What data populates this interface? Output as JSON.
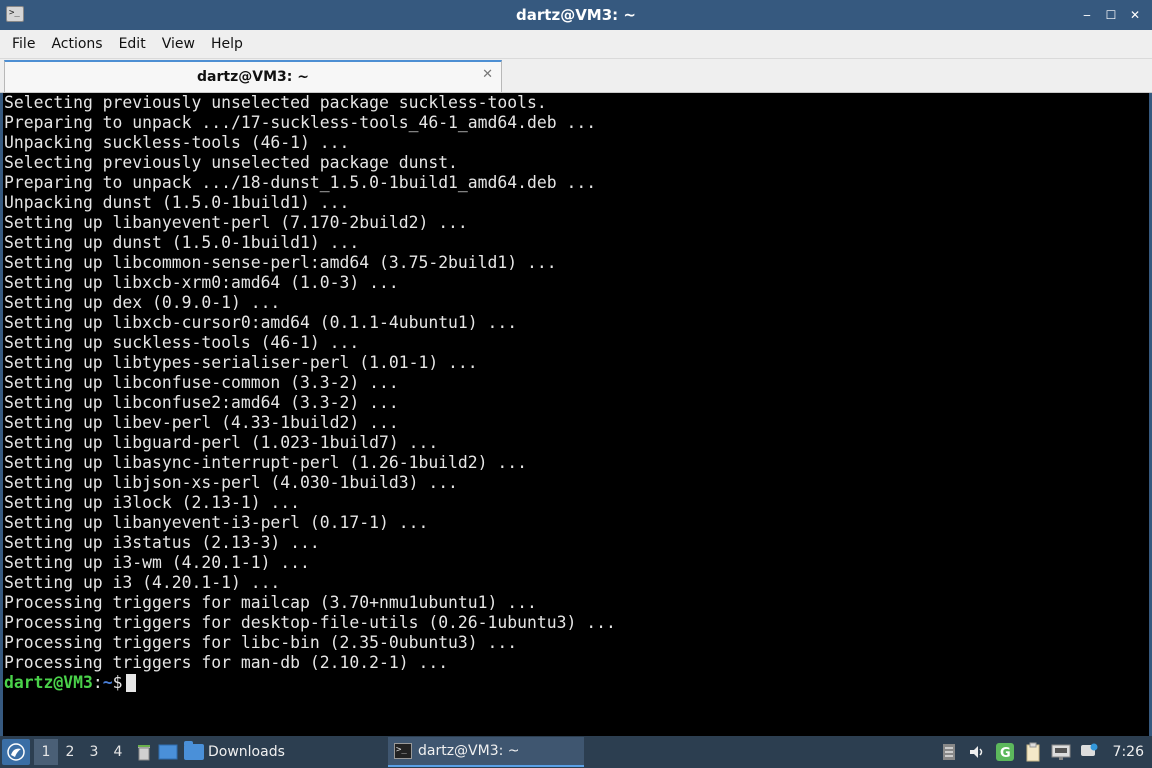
{
  "window": {
    "title": "dartz@VM3: ~",
    "minimize_label": "‒",
    "maximize_label": "☐",
    "close_label": "✕"
  },
  "menu": {
    "items": [
      "File",
      "Actions",
      "Edit",
      "View",
      "Help"
    ]
  },
  "tab": {
    "label": "dartz@VM3: ~",
    "close_label": "✕"
  },
  "terminal": {
    "lines": [
      "Selecting previously unselected package suckless-tools.",
      "Preparing to unpack .../17-suckless-tools_46-1_amd64.deb ...",
      "Unpacking suckless-tools (46-1) ...",
      "Selecting previously unselected package dunst.",
      "Preparing to unpack .../18-dunst_1.5.0-1build1_amd64.deb ...",
      "Unpacking dunst (1.5.0-1build1) ...",
      "Setting up libanyevent-perl (7.170-2build2) ...",
      "Setting up dunst (1.5.0-1build1) ...",
      "Setting up libcommon-sense-perl:amd64 (3.75-2build1) ...",
      "Setting up libxcb-xrm0:amd64 (1.0-3) ...",
      "Setting up dex (0.9.0-1) ...",
      "Setting up libxcb-cursor0:amd64 (0.1.1-4ubuntu1) ...",
      "Setting up suckless-tools (46-1) ...",
      "Setting up libtypes-serialiser-perl (1.01-1) ...",
      "Setting up libconfuse-common (3.3-2) ...",
      "Setting up libconfuse2:amd64 (3.3-2) ...",
      "Setting up libev-perl (4.33-1build2) ...",
      "Setting up libguard-perl (1.023-1build7) ...",
      "Setting up libasync-interrupt-perl (1.26-1build2) ...",
      "Setting up libjson-xs-perl (4.030-1build3) ...",
      "Setting up i3lock (2.13-1) ...",
      "Setting up libanyevent-i3-perl (0.17-1) ...",
      "Setting up i3status (2.13-3) ...",
      "Setting up i3-wm (4.20.1-1) ...",
      "Setting up i3 (4.20.1-1) ...",
      "Processing triggers for mailcap (3.70+nmu1ubuntu1) ...",
      "Processing triggers for desktop-file-utils (0.26-1ubuntu3) ...",
      "Processing triggers for libc-bin (2.35-0ubuntu3) ...",
      "Processing triggers for man-db (2.10.2-1) ..."
    ],
    "prompt": {
      "user_host": "dartz@VM3",
      "colon": ":",
      "path": "~",
      "symbol": "$"
    }
  },
  "taskbar": {
    "workspaces": [
      "1",
      "2",
      "3",
      "4"
    ],
    "active_workspace": "1",
    "tasks": [
      {
        "label": "Downloads",
        "icon": "folder-icon"
      },
      {
        "label": "dartz@VM3: ~",
        "icon": "terminal-icon"
      }
    ],
    "clock": "7:26",
    "colors": {
      "taskbar_bg": "#2c3e50",
      "title_bg": "#36597f",
      "prompt_user": "#4ad24a",
      "prompt_path": "#4a7fd8"
    }
  }
}
